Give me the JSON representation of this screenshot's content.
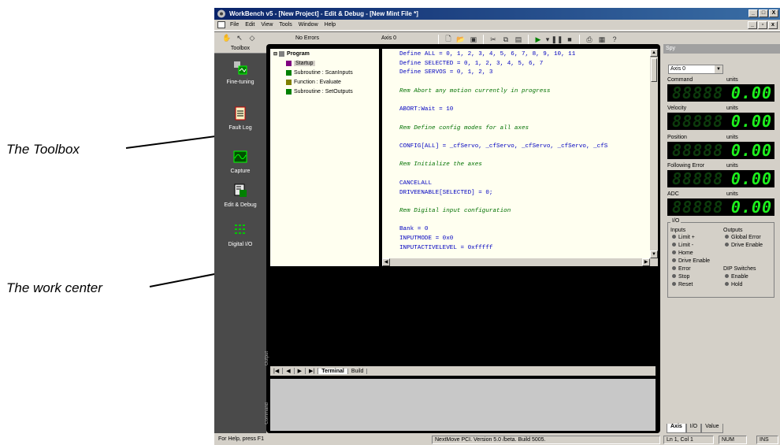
{
  "annotations": {
    "toolbox": "The Toolbox",
    "workcenter": "The work center"
  },
  "window": {
    "title": "WorkBench v5 - [New Project] - Edit & Debug - [New Mint File *]",
    "title_buttons": [
      "_",
      "□",
      "X"
    ],
    "mdi_buttons": [
      "_",
      "Ɛ",
      "X"
    ]
  },
  "menu": [
    "File",
    "Edit",
    "View",
    "Tools",
    "Window",
    "Help"
  ],
  "toolbar": {
    "status": "No Errors",
    "axis": "Axis 0"
  },
  "toolbox": {
    "header": "Toolbox",
    "items": [
      {
        "label": "Fine-tuning",
        "icon": "fine-tuning-icon"
      },
      {
        "label": "Fault Log",
        "icon": "fault-log-icon"
      },
      {
        "label": "Capture",
        "icon": "capture-icon"
      },
      {
        "label": "Edit & Debug",
        "icon": "edit-debug-icon"
      },
      {
        "label": "Digital I/O",
        "icon": "digital-io-icon"
      }
    ]
  },
  "tree": {
    "root": "Program",
    "items": [
      "Startup",
      "Subroutine : ScanInputs",
      "Function : Evaluate",
      "Subroutine : SetOutputs"
    ]
  },
  "code": [
    {
      "t": "kw",
      "s": "Define ALL = 0, 1, 2, 3, 4, 5, 6, 7, 8, 9, 10, 11"
    },
    {
      "t": "kw",
      "s": "Define SELECTED = 0, 1, 2, 3, 4, 5, 6, 7"
    },
    {
      "t": "kw",
      "s": "Define SERVOS = 0, 1, 2, 3"
    },
    {
      "t": "",
      "s": ""
    },
    {
      "t": "cm",
      "s": "Rem Abort any motion currently in progress"
    },
    {
      "t": "",
      "s": ""
    },
    {
      "t": "kw",
      "s": "ABORT:Wait = 10"
    },
    {
      "t": "",
      "s": ""
    },
    {
      "t": "cm",
      "s": "Rem Define config modes for all axes"
    },
    {
      "t": "",
      "s": ""
    },
    {
      "t": "kw",
      "s": "CONFIG[ALL] = _cfServo, _cfServo, _cfServo, _cfServo, _cfS"
    },
    {
      "t": "",
      "s": ""
    },
    {
      "t": "cm",
      "s": "Rem Initialize the axes"
    },
    {
      "t": "",
      "s": ""
    },
    {
      "t": "kw",
      "s": "CANCELALL"
    },
    {
      "t": "kw",
      "s": "DRIVEENABLE[SELECTED] = 0;"
    },
    {
      "t": "",
      "s": ""
    },
    {
      "t": "cm",
      "s": "Rem Digital input configuration"
    },
    {
      "t": "",
      "s": ""
    },
    {
      "t": "kw",
      "s": "Bank = 0"
    },
    {
      "t": "kw",
      "s": "INPUTMODE = 0x0"
    },
    {
      "t": "kw",
      "s": "INPUTACTIVELEVEL = 0xfffff"
    }
  ],
  "output": {
    "side_label": "Output",
    "tabs": [
      "Terminal",
      "Build"
    ],
    "nav_arrows": [
      "|◀",
      "◀",
      "▶",
      "▶|"
    ]
  },
  "command": {
    "side_label": "Command"
  },
  "panel": {
    "header": "Spy",
    "axis_select": "Axis 0",
    "meters": [
      {
        "label": "Command",
        "unit": "units",
        "value": "0.00"
      },
      {
        "label": "Velocity",
        "unit": "units",
        "value": "0.00"
      },
      {
        "label": "Position",
        "unit": "units",
        "value": "0.00"
      },
      {
        "label": "Following Error",
        "unit": "units",
        "value": "0.00"
      },
      {
        "label": "ADC",
        "unit": "units",
        "value": "0.00"
      }
    ],
    "io_title": "I/O",
    "inputs_title": "Inputs",
    "outputs_title": "Outputs",
    "inputs": [
      "Limit +",
      "Limit -",
      "Home",
      "Drive Enable",
      "Error",
      "Stop",
      "Reset"
    ],
    "outputs": [
      "Global Error",
      "Drive Enable"
    ],
    "dip_title": "DIP Switches",
    "dip": [
      "Enable",
      "Hold"
    ],
    "tabs": [
      "Axis",
      "I/O",
      "Value"
    ]
  },
  "statusbar": {
    "help": "For Help, press F1",
    "version": "NextMove PCI. Version 5.0 /beta. Build 5005.",
    "position": "Ln 1, Col 1",
    "num": "NUM",
    "ins": "INS"
  }
}
